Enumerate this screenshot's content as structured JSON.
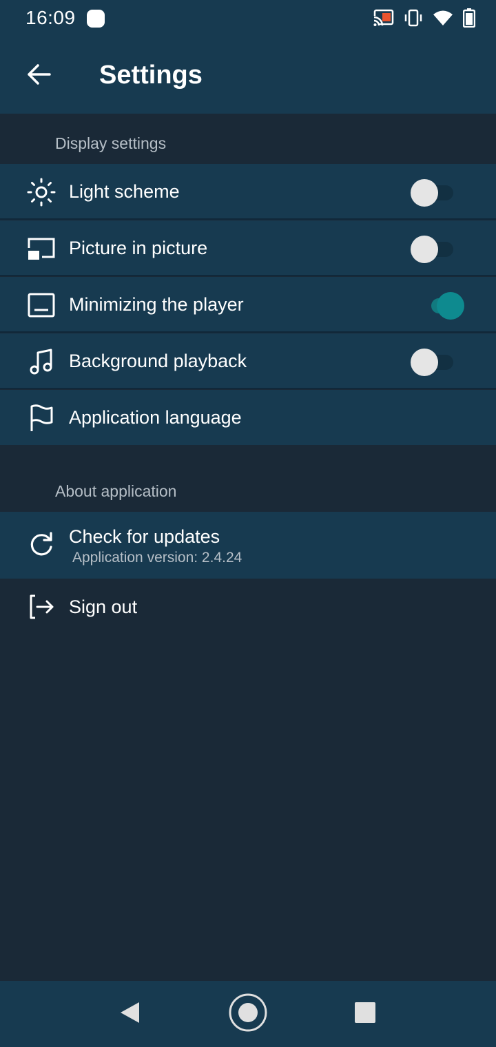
{
  "status_bar": {
    "time": "16:09",
    "icons": [
      "notification-icon",
      "cast-icon",
      "vibrate-icon",
      "wifi-icon",
      "battery-icon"
    ]
  },
  "app_bar": {
    "title": "Settings",
    "back_icon": "arrow-left-icon"
  },
  "sections": {
    "display": {
      "header": "Display settings",
      "items": [
        {
          "label": "Light scheme",
          "icon": "sun-icon",
          "toggle": false
        },
        {
          "label": "Picture in picture",
          "icon": "picture-in-picture-icon",
          "toggle": false
        },
        {
          "label": "Minimizing the player",
          "icon": "minimize-player-icon",
          "toggle": true
        },
        {
          "label": "Background playback",
          "icon": "music-note-icon",
          "toggle": false
        },
        {
          "label": "Application language",
          "icon": "flag-icon"
        }
      ]
    },
    "about": {
      "header": "About application",
      "check_updates": {
        "label": "Check for updates",
        "subtitle": "Application version: 2.4.24",
        "icon": "refresh-icon"
      },
      "sign_out": {
        "label": "Sign out",
        "icon": "sign-out-icon"
      }
    }
  },
  "nav_bar": {
    "buttons": [
      "back-triangle-icon",
      "home-circle-icon",
      "recents-square-icon"
    ]
  },
  "colors": {
    "bar_background": "#173a50",
    "page_background": "#1a2937",
    "accent": "#0e8a8f",
    "secondary_text": "#b6bfc7"
  }
}
